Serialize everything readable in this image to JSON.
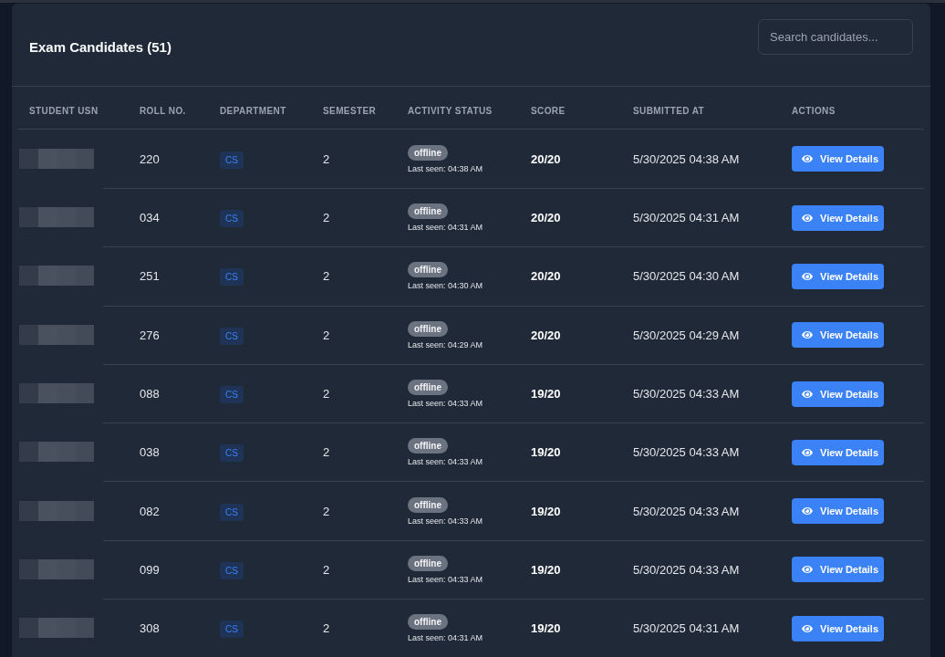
{
  "header": {
    "title": "Exam Candidates (51)",
    "search": {
      "placeholder": "Search candidates..."
    }
  },
  "table": {
    "columns": [
      "STUDENT USN",
      "ROLL NO.",
      "DEPARTMENT",
      "SEMESTER",
      "ACTIVITY STATUS",
      "SCORE",
      "SUBMITTED AT",
      "ACTIONS"
    ],
    "rows": [
      {
        "usn_redacted": true,
        "roll_no": "220",
        "department": "CS",
        "semester": "2",
        "status": {
          "label": "offline",
          "online": false,
          "last_seen": "Last seen: 04:38 AM"
        },
        "score": "20/20",
        "submitted_at": "5/30/2025 04:38 AM",
        "action": "View Details"
      },
      {
        "usn_redacted": true,
        "roll_no": "034",
        "department": "CS",
        "semester": "2",
        "status": {
          "label": "offline",
          "online": false,
          "last_seen": "Last seen: 04:31 AM"
        },
        "score": "20/20",
        "submitted_at": "5/30/2025 04:31 AM",
        "action": "View Details"
      },
      {
        "usn_redacted": true,
        "roll_no": "251",
        "department": "CS",
        "semester": "2",
        "status": {
          "label": "offline",
          "online": false,
          "last_seen": "Last seen: 04:30 AM"
        },
        "score": "20/20",
        "submitted_at": "5/30/2025 04:30 AM",
        "action": "View Details"
      },
      {
        "usn_redacted": true,
        "roll_no": "276",
        "department": "CS",
        "semester": "2",
        "status": {
          "label": "offline",
          "online": false,
          "last_seen": "Last seen: 04:29 AM"
        },
        "score": "20/20",
        "submitted_at": "5/30/2025 04:29 AM",
        "action": "View Details"
      },
      {
        "usn_redacted": true,
        "roll_no": "088",
        "department": "CS",
        "semester": "2",
        "status": {
          "label": "offline",
          "online": false,
          "last_seen": "Last seen: 04:33 AM"
        },
        "score": "19/20",
        "submitted_at": "5/30/2025 04:33 AM",
        "action": "View Details"
      },
      {
        "usn_redacted": true,
        "roll_no": "038",
        "department": "CS",
        "semester": "2",
        "status": {
          "label": "offline",
          "online": false,
          "last_seen": "Last seen: 04:33 AM"
        },
        "score": "19/20",
        "submitted_at": "5/30/2025 04:33 AM",
        "action": "View Details"
      },
      {
        "usn_redacted": true,
        "roll_no": "082",
        "department": "CS",
        "semester": "2",
        "status": {
          "label": "offline",
          "online": false,
          "last_seen": "Last seen: 04:33 AM"
        },
        "score": "19/20",
        "submitted_at": "5/30/2025 04:33 AM",
        "action": "View Details"
      },
      {
        "usn_redacted": true,
        "roll_no": "099",
        "department": "CS",
        "semester": "2",
        "status": {
          "label": "offline",
          "online": false,
          "last_seen": "Last seen: 04:33 AM"
        },
        "score": "19/20",
        "submitted_at": "5/30/2025 04:33 AM",
        "action": "View Details"
      },
      {
        "usn_redacted": true,
        "roll_no": "308",
        "department": "CS",
        "semester": "2",
        "status": {
          "label": "offline",
          "online": false,
          "last_seen": "Last seen: 04:31 AM"
        },
        "score": "19/20",
        "submitted_at": "5/30/2025 04:31 AM",
        "action": "View Details"
      }
    ]
  }
}
